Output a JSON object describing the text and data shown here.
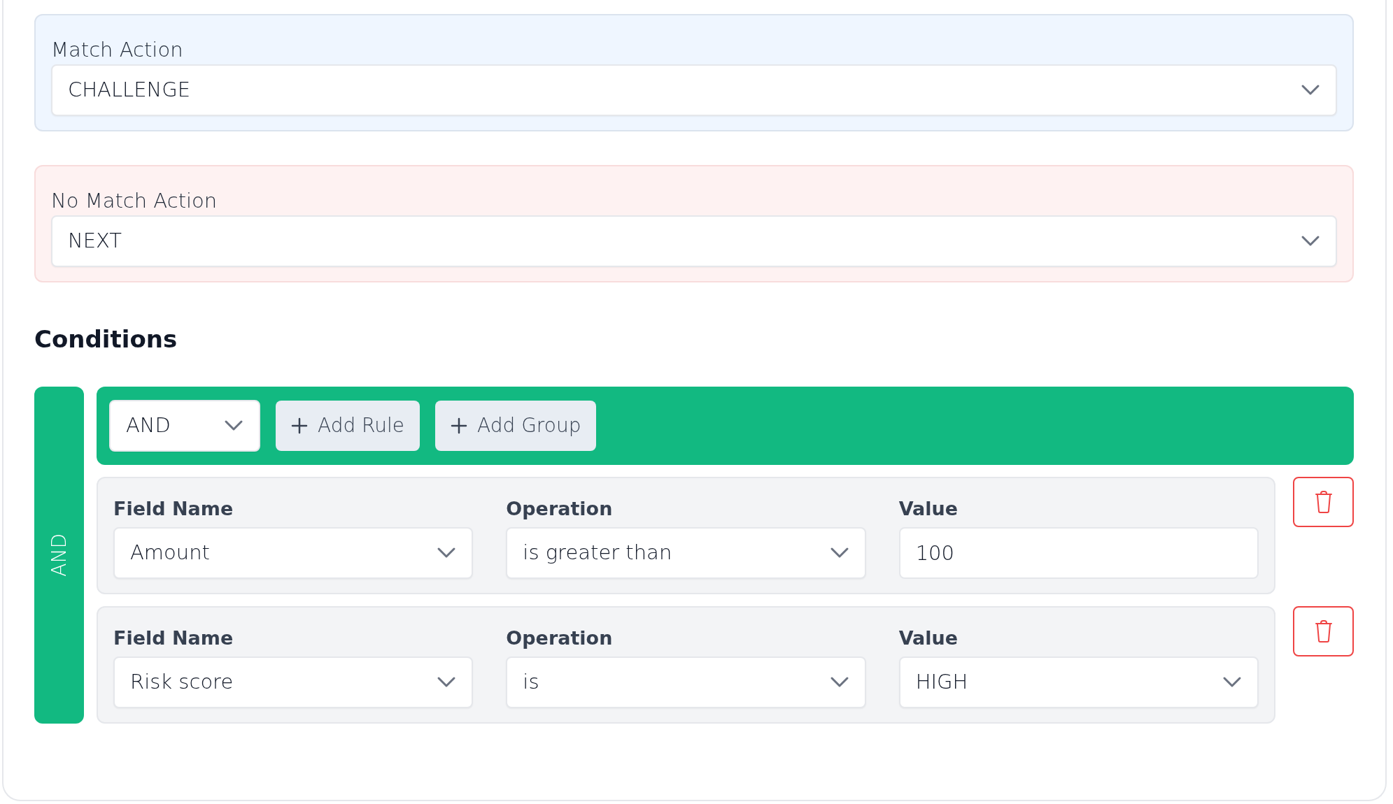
{
  "actions": [
    {
      "label": "Match Action",
      "value": "CHALLENGE",
      "color": "#eff6ff"
    },
    {
      "label": "No Match Action",
      "value": "NEXT",
      "color": "#fef2f2"
    }
  ],
  "conditions": {
    "title": "Conditions",
    "group": {
      "side_label": "AND",
      "combinator": "AND",
      "buttons": [
        {
          "label": "Add Rule"
        },
        {
          "label": "Add Group"
        }
      ],
      "rules": [
        {
          "fields": [
            {
              "label": "Field Name",
              "value": "Amount",
              "kind": "select"
            },
            {
              "label": "Operation",
              "value": "is greater than",
              "kind": "select"
            },
            {
              "label": "Value",
              "value": "100",
              "kind": "input"
            }
          ]
        },
        {
          "fields": [
            {
              "label": "Field Name",
              "value": "Risk score",
              "kind": "select"
            },
            {
              "label": "Operation",
              "value": "is",
              "kind": "select"
            },
            {
              "label": "Value",
              "value": "HIGH",
              "kind": "select"
            }
          ]
        }
      ]
    }
  }
}
